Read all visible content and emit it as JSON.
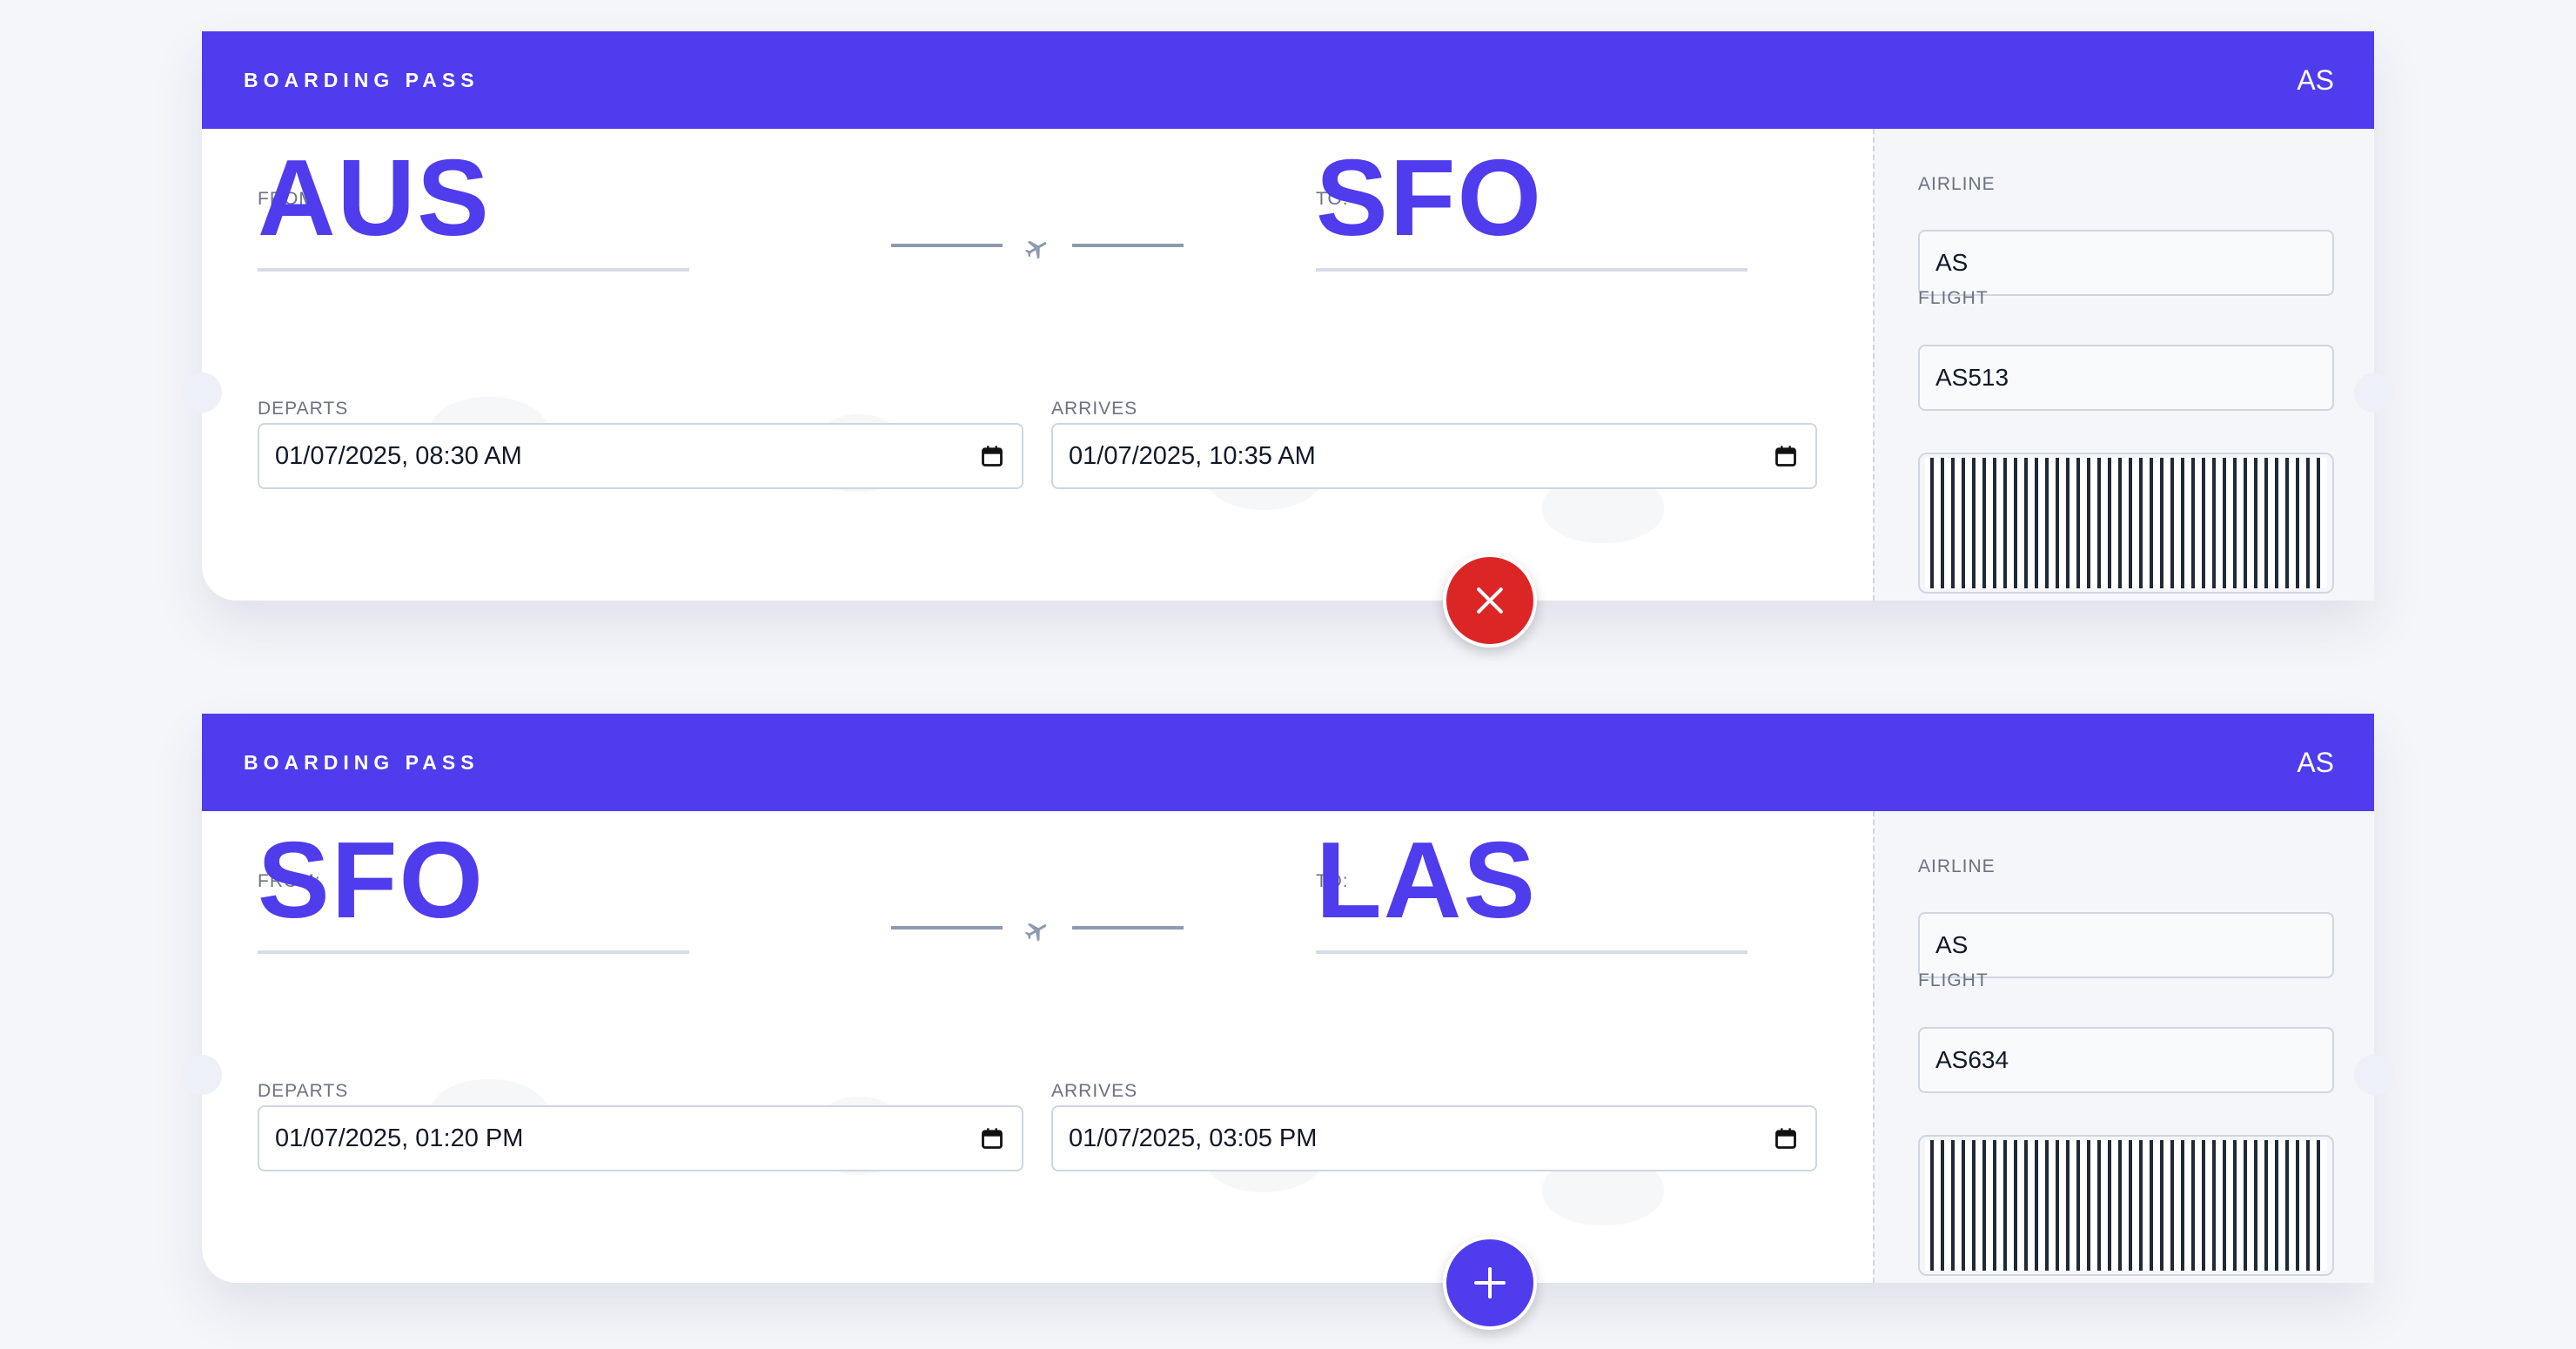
{
  "colors": {
    "accent": "#4f3ced",
    "remove": "#dc2626",
    "add": "#4f3ced"
  },
  "passes": [
    {
      "header_title": "BOARDING PASS",
      "header_code": "AS",
      "from_label": "FROM:",
      "from_code": "AUS",
      "to_label": "TO:",
      "to_code": "SFO",
      "departs_label": "DEPARTS",
      "departs_value": "01/07/2025, 08:30 AM",
      "arrives_label": "ARRIVES",
      "arrives_value": "01/07/2025, 10:35 AM",
      "airline_label": "AIRLINE",
      "airline_value": "AS",
      "flight_label": "FLIGHT",
      "flight_value": "AS513",
      "action_icon": "close-icon"
    },
    {
      "header_title": "BOARDING PASS",
      "header_code": "AS",
      "from_label": "FROM:",
      "from_code": "SFO",
      "to_label": "TO:",
      "to_code": "LAS",
      "departs_label": "DEPARTS",
      "departs_value": "01/07/2025, 01:20 PM",
      "arrives_label": "ARRIVES",
      "arrives_value": "01/07/2025, 03:05 PM",
      "airline_label": "AIRLINE",
      "airline_value": "AS",
      "flight_label": "FLIGHT",
      "flight_value": "AS634",
      "action_icon": "plus-icon"
    }
  ]
}
